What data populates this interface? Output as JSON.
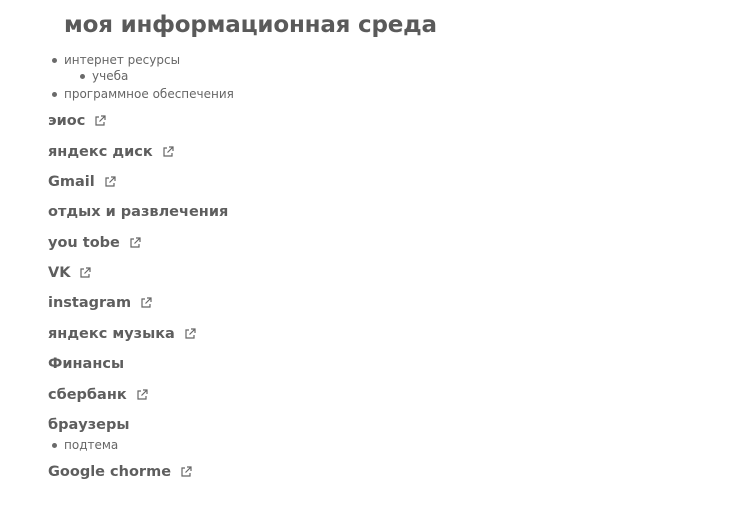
{
  "title": "моя информационная среда",
  "outline": {
    "item1": "интернет ресурсы",
    "item1_sub": "учеба",
    "item2": "программное обеспечения"
  },
  "links": {
    "eios": "эиос",
    "yandex_disk": "яндекс диск",
    "gmail": "Gmail",
    "youtube": "you tobe",
    "vk": "VK",
    "instagram": "instagram",
    "yandex_music": "яндекс музыка",
    "sberbank": "сбербанк",
    "google_chrome": "Google chorme"
  },
  "headings": {
    "leisure": "отдых и развлечения",
    "finance": "Финансы",
    "browsers": "браузеры"
  },
  "browsers_sub": "подтема",
  "icon_name": "external-link-icon"
}
